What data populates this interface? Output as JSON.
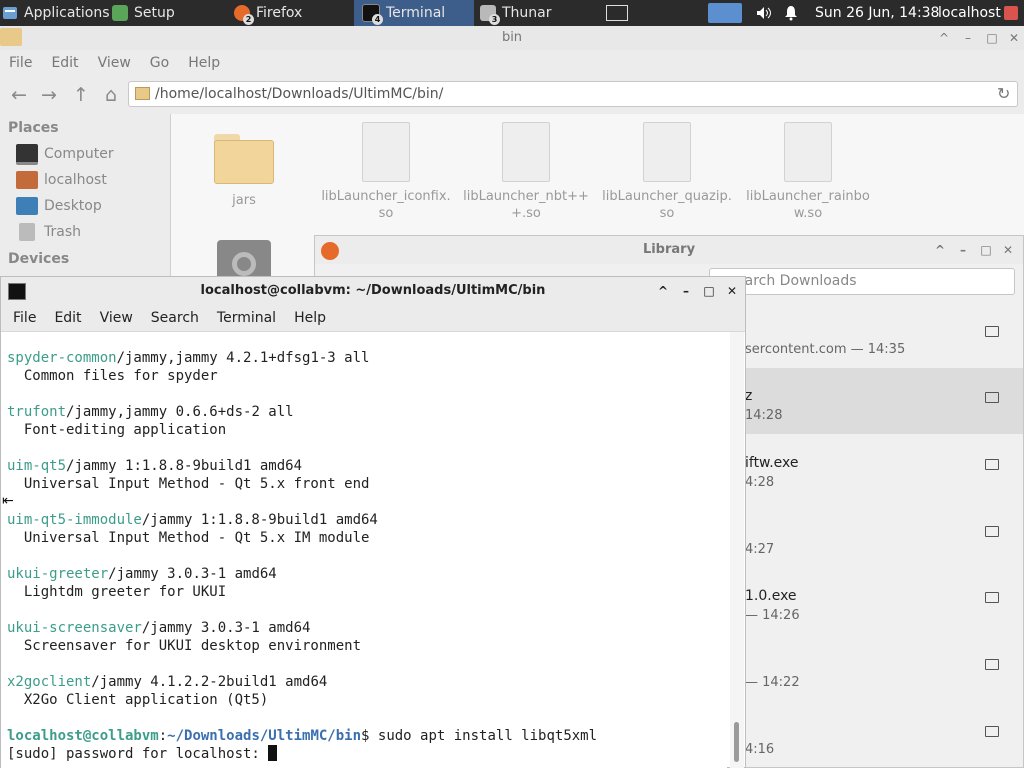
{
  "taskbar": {
    "applications_label": "Applications",
    "tasks": [
      {
        "label": "Setup",
        "badge": ""
      },
      {
        "label": "Firefox",
        "badge": "2"
      },
      {
        "label": "Terminal",
        "badge": "4"
      },
      {
        "label": "Thunar",
        "badge": "3"
      }
    ],
    "clock": "Sun 26 Jun, 14:38",
    "user": "localhost"
  },
  "thunar": {
    "title": "bin",
    "menu": [
      "File",
      "Edit",
      "View",
      "Go",
      "Help"
    ],
    "path": "/home/localhost/Downloads/UltimMC/bin/",
    "sidebar": {
      "places_heading": "Places",
      "places": [
        "Computer",
        "localhost",
        "Desktop",
        "Trash"
      ],
      "devices_heading": "Devices"
    },
    "files": [
      {
        "name_line1": "jars",
        "name_line2": ""
      },
      {
        "name_line1": "libLauncher_iconfix.",
        "name_line2": "so"
      },
      {
        "name_line1": "libLauncher_nbt++",
        "name_line2": "+.so"
      },
      {
        "name_line1": "libLauncher_quazip.",
        "name_line2": "so"
      },
      {
        "name_line1": "libLauncher_rainbo",
        "name_line2": "w.so"
      }
    ]
  },
  "library": {
    "title": "Library",
    "search_placeholder": "earch Downloads",
    "downloads": [
      {
        "name": "",
        "meta": "sercontent.com — 14:35"
      },
      {
        "name": "z",
        "meta": "14:28"
      },
      {
        "name": "iftw.exe",
        "meta": "4:28"
      },
      {
        "name": "",
        "meta": "4:27"
      },
      {
        "name": "1.0.exe",
        "meta": "— 14:26"
      },
      {
        "name": "",
        "meta": "— 14:22"
      },
      {
        "name": "",
        "meta": "4:16"
      }
    ]
  },
  "terminal": {
    "title": "localhost@collabvm: ~/Downloads/UltimMC/bin",
    "menu": [
      "File",
      "Edit",
      "View",
      "Search",
      "Terminal",
      "Help"
    ],
    "entries": [
      {
        "pkg": "spyder-common",
        "rest": "/jammy,jammy 4.2.1+dfsg1-3 all",
        "desc": "  Common files for spyder"
      },
      {
        "pkg": "trufont",
        "rest": "/jammy,jammy 0.6.6+ds-2 all",
        "desc": "  Font-editing application"
      },
      {
        "pkg": "uim-qt5",
        "rest": "/jammy 1:1.8.8-9build1 amd64",
        "desc": "  Universal Input Method - Qt 5.x front end"
      },
      {
        "pkg": "uim-qt5-immodule",
        "rest": "/jammy 1:1.8.8-9build1 amd64",
        "desc": "  Universal Input Method - Qt 5.x IM module"
      },
      {
        "pkg": "ukui-greeter",
        "rest": "/jammy 3.0.3-1 amd64",
        "desc": "  Lightdm greeter for UKUI"
      },
      {
        "pkg": "ukui-screensaver",
        "rest": "/jammy 3.0.3-1 amd64",
        "desc": "  Screensaver for UKUI desktop environment"
      },
      {
        "pkg": "x2goclient",
        "rest": "/jammy 4.1.2.2-2build1 amd64",
        "desc": "  X2Go Client application (Qt5)"
      }
    ],
    "prompt_user": "localhost@collabvm",
    "prompt_sep": ":",
    "prompt_path": "~/Downloads/UltimMC/bin",
    "prompt_cmd": "$ sudo apt install libqt5xml",
    "sudo_prompt": "[sudo] password for localhost: "
  },
  "colors": {
    "taskbar_bg": "#2b2b2b",
    "active_task": "#3d5d8a",
    "package_name": "#3c9d8a",
    "prompt_path": "#3a6fb0"
  }
}
